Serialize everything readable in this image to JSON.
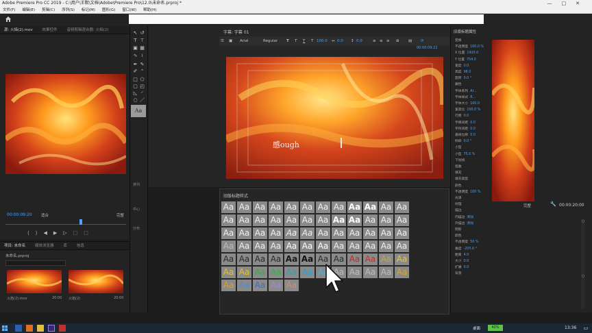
{
  "window": {
    "title": "Adobe Premiere Pro CC 2019 - C:\\用户\\王默\\文档\\Adobe\\Premiere Pro\\12.0\\未命名.prproj *"
  },
  "menu": [
    "文件(F)",
    "编辑(E)",
    "剪辑(C)",
    "序列(S)",
    "标记(M)",
    "图形(G)",
    "窗口(W)",
    "帮助(H)"
  ],
  "source": {
    "tabs": [
      "源: 火焰(2).mov",
      "效果控件",
      "音频剪辑混合器: 火焰(2)"
    ],
    "timecode": "00:00:09:20",
    "fit": "适合",
    "full": "完整"
  },
  "project": {
    "tabs": [
      "项目: 未命名",
      "媒体浏览器",
      "库",
      "信息"
    ],
    "file": "未命名.prproj",
    "clips": [
      {
        "name": "火焰(2).mov",
        "duration": "20:00"
      },
      {
        "name": "火焰(2)",
        "duration": "20:00"
      }
    ]
  },
  "tools": {
    "labels": [
      "排列",
      "中心",
      "分布"
    ],
    "style_thumb": "Aa"
  },
  "title_designer": {
    "header": "字幕: 字幕 01",
    "font": "Arial",
    "weight": "Regular",
    "size": "100.0",
    "kerning": "0.0",
    "leading": "0.0",
    "timecode": "00:00:09:22",
    "canvas_text": "感ough"
  },
  "styles": {
    "header": "旧版标题样式",
    "swatch_text": "Aa",
    "rows": [
      [
        "#8a8a8a",
        "#8a8a8a",
        "#8a8a8a",
        "#8a8a8a",
        "#8a8a8a",
        "#8a8a8a",
        "#8a8a8a",
        "#8a8a8a",
        "#8a8a8a",
        "#8a8a8a",
        "#8a8a8a",
        "#8a8a8a"
      ],
      [
        "#8a8a8a",
        "#8a8a8a",
        "#8a8a8a",
        "#8a8a8a",
        "#8a8a8a",
        "#8a8a8a",
        "#8a8a8a",
        "#8a8a8a",
        "#8a8a8a",
        "#8a8a8a",
        "#8a8a8a",
        "#8a8a8a"
      ],
      [
        "#8a8a8a",
        "#8a8a8a",
        "#8a8a8a",
        "#8a8a8a",
        "#8a8a8a",
        "#8a8a8a",
        "#8a8a8a",
        "#8a8a8a",
        "#8a8a8a",
        "#8a8a8a",
        "#8a8a8a",
        "#8a8a8a"
      ],
      [
        "#8a8a8a",
        "#8a8a8a",
        "#8a8a8a",
        "#8a8a8a",
        "#8a8a8a",
        "#8a8a8a",
        "#8a8a8a",
        "#8a8a8a",
        "#8a8a8a",
        "#8a8a8a",
        "#8a8a8a",
        "#8a8a8a"
      ],
      [
        "#8a8a8a",
        "#8a8a8a",
        "#8a8a8a",
        "#8a8a8a",
        "#8a8a8a",
        "#8a8a8a",
        "#8a8a8a",
        "#8a8a8a",
        "#8a8a8a",
        "#8a8a8a",
        "#8a8a8a",
        "#8a8a8a"
      ],
      [
        "#8a8a8a",
        "#8a8a8a",
        "#8a8a8a",
        "#8a8a8a",
        "#8a8a8a",
        "#8a8a8a",
        "#8a8a8a",
        "#8a8a8a",
        "#8a8a8a",
        "#8a8a8a",
        "#8a8a8a",
        "#8a8a8a"
      ],
      [
        "#8a8a8a",
        "#8a8a8a",
        "#8a8a8a",
        "#8a8a8a",
        "#8a8a8a"
      ]
    ],
    "text_colors": [
      [
        "#f0f0f0",
        "#f0f0f0",
        "#f0f0f0",
        "#f0f0f0",
        "#f0f0f0",
        "#f0f0f0",
        "#f0f0f0",
        "#f0f0f0",
        "#ffffff",
        "#ffffff",
        "#f0f0f0",
        "#f0f0f0"
      ],
      [
        "#f0f0f0",
        "#f0f0f0",
        "#f0f0f0",
        "#f0f0f0",
        "#f0f0f0",
        "#f0f0f0",
        "#f0f0f0",
        "#ffffff",
        "#ffffff",
        "#f0f0f0",
        "#f0f0f0",
        "#f0f0f0"
      ],
      [
        "#f0f0f0",
        "#f0f0f0",
        "#f0f0f0",
        "#f0f0f0",
        "#f0f0f0",
        "#f0f0f0",
        "#f0f0f0",
        "#f0f0f0",
        "#f0f0f0",
        "#f0f0f0",
        "#f0f0f0",
        "#f0f0f0"
      ],
      [
        "#bdbdbd",
        "#f0f0f0",
        "#f0f0f0",
        "#f0f0f0",
        "#ffffff",
        "#ffffff",
        "#ffffff",
        "#f0f0f0",
        "#f0f0f0",
        "#f0f0f0",
        "#f0f0f0",
        "#f0f0f0"
      ],
      [
        "#2a2a2a",
        "#2a2a2a",
        "#2a2a2a",
        "#2a2a2a",
        "#1a1a1a",
        "#111111",
        "#2a2a2a",
        "#2a2a2a",
        "#c0282a",
        "#d6282a",
        "#c9a24a",
        "#e4c640"
      ],
      [
        "#e8c22a",
        "#e8c22a",
        "#2fae4a",
        "#2fae4a",
        "#2aa0b4",
        "#2aa0d8",
        "#46b4e0",
        "#bdbdbd",
        "#bdbdbd",
        "#bdbdbd",
        "#bdbdbd",
        "#d9a52a"
      ],
      [
        "#e0a020",
        "#4e8ad8",
        "#3a6cd0",
        "#a08ad0",
        "#d88a6a"
      ]
    ]
  },
  "properties": {
    "header": "旧版标题属性",
    "rows": [
      {
        "label": "变换",
        "value": ""
      },
      {
        "label": "不透明度",
        "value": "100.0 %"
      },
      {
        "label": "X 位置",
        "value": "1920.0"
      },
      {
        "label": "Y 位置",
        "value": "754.0"
      },
      {
        "label": "宽度",
        "value": "0.0"
      },
      {
        "label": "高度",
        "value": "98.0"
      },
      {
        "label": "旋转",
        "value": "0.0 °"
      },
      {
        "label": "属性",
        "value": ""
      },
      {
        "label": "字体系列",
        "value": "Ar..."
      },
      {
        "label": "字体样式",
        "value": "R..."
      },
      {
        "label": "字体大小",
        "value": "100.0"
      },
      {
        "label": "宽高比",
        "value": "100.0 %"
      },
      {
        "label": "行距",
        "value": "0.0"
      },
      {
        "label": "字偶间距",
        "value": "0.0"
      },
      {
        "label": "字符间距",
        "value": "0.0"
      },
      {
        "label": "基线位移",
        "value": "0.0"
      },
      {
        "label": "倾斜",
        "value": "0.0 °"
      },
      {
        "label": "小型",
        "value": ""
      },
      {
        "label": "小型",
        "value": "75.0 %"
      },
      {
        "label": "下划线",
        "value": ""
      },
      {
        "label": "扭曲",
        "value": ""
      },
      {
        "label": "填充",
        "value": ""
      },
      {
        "label": "填充类型",
        "value": ""
      },
      {
        "label": "颜色",
        "value": ""
      },
      {
        "label": "不透明度",
        "value": "100 %"
      },
      {
        "label": "光泽",
        "value": ""
      },
      {
        "label": "纹理",
        "value": ""
      },
      {
        "label": "描边",
        "value": ""
      },
      {
        "label": "内描边",
        "value": "添加"
      },
      {
        "label": "外描边",
        "value": "添加"
      },
      {
        "label": "阴影",
        "value": ""
      },
      {
        "label": "颜色",
        "value": ""
      },
      {
        "label": "不透明度",
        "value": "50 %"
      },
      {
        "label": "角度",
        "value": "-205.0 °"
      },
      {
        "label": "距离",
        "value": "4.0"
      },
      {
        "label": "大小",
        "value": "0.0"
      },
      {
        "label": "扩展",
        "value": "0.0"
      },
      {
        "label": "背景",
        "value": ""
      }
    ]
  },
  "program": {
    "fit": "完整",
    "timecode": "00:00:20:00"
  },
  "taskbar": {
    "tray_label": "桌面",
    "battery": "42%",
    "clock": "13:36"
  },
  "colors": {
    "accent_blue": "#4aa3ff",
    "panel_bg": "#232323",
    "battery_green": "#5fc14c"
  }
}
